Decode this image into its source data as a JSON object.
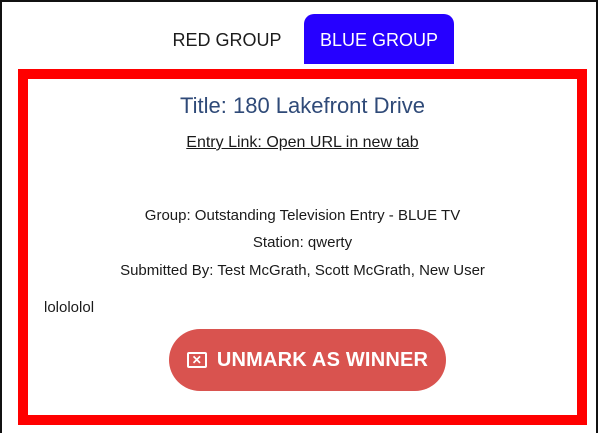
{
  "tabs": {
    "red_label": "RED GROUP",
    "blue_label": "BLUE GROUP"
  },
  "entry": {
    "title": "Title: 180 Lakefront Drive",
    "link_text": "Entry Link: Open URL in new tab",
    "group": "Group: Outstanding Television Entry - BLUE TV",
    "station": "Station: qwerty",
    "submitted_by": "Submitted By: Test McGrath, Scott McGrath, New User",
    "note": "lolololol"
  },
  "actions": {
    "unmark_label": "UNMARK AS WINNER",
    "unmark_icon": "x-box-icon"
  },
  "colors": {
    "active_tab": "#2600ff",
    "panel_border": "#ff0000",
    "button": "#d9534f",
    "title": "#2f4a78"
  }
}
